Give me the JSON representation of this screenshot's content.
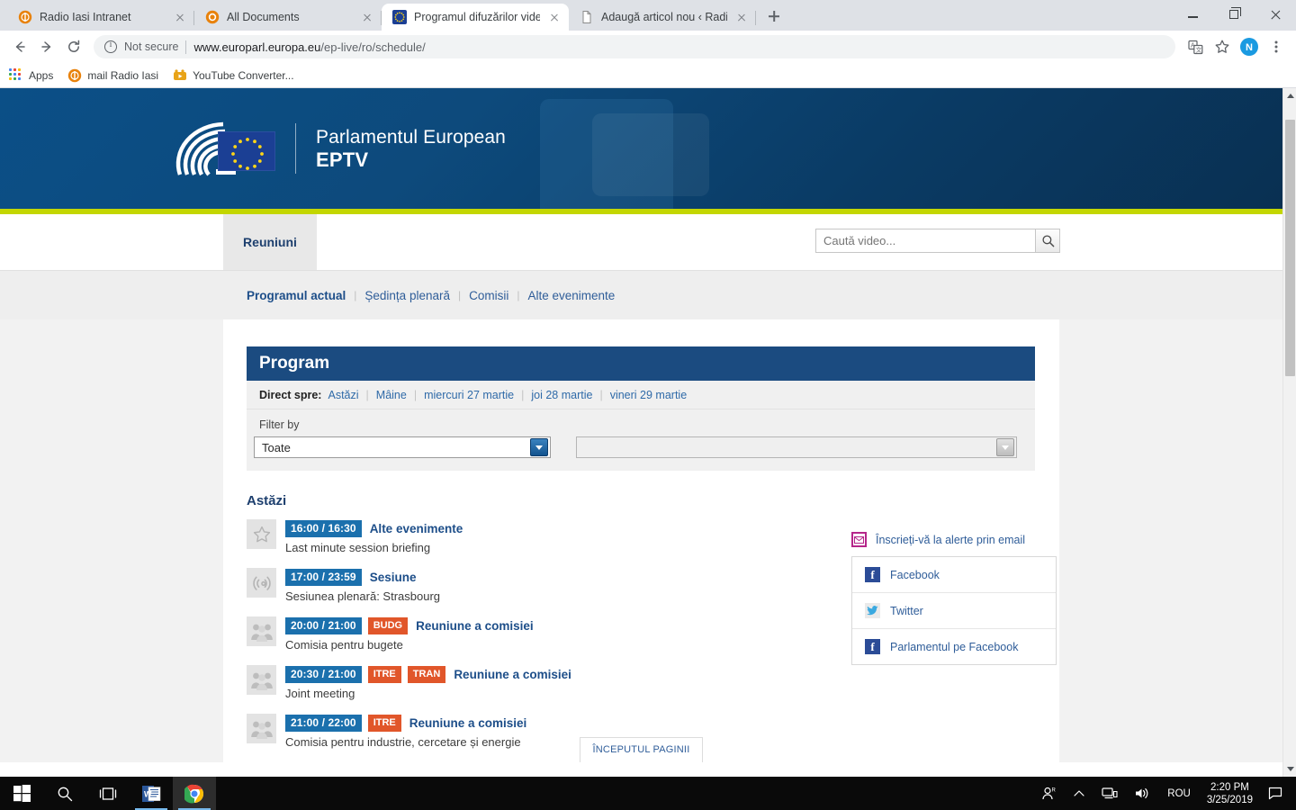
{
  "browser": {
    "tabs": [
      {
        "title": "Radio Iasi Intranet",
        "favicon": "radio-orange-icon",
        "active": false
      },
      {
        "title": "All Documents",
        "favicon": "sharepoint-orange-icon",
        "active": false
      },
      {
        "title": "Programul difuzărilor video | Mul",
        "favicon": "eu-flag-icon",
        "active": true
      },
      {
        "title": "Adaugă articol nou ‹ Radio Iaşi –",
        "favicon": "page-icon",
        "active": false
      }
    ],
    "new_tab_label": "+",
    "window_controls": {
      "minimize": "minimize-button",
      "maximize": "maximize-button",
      "close": "close-button"
    },
    "omnibox": {
      "security_label": "Not secure",
      "url_host": "www.europarl.europa.eu",
      "url_path": "/ep-live/ro/schedule/"
    },
    "toolbar_icons": [
      "back-icon",
      "forward-icon",
      "reload-icon",
      "translate-icon",
      "bookmark-star-icon",
      "profile-avatar",
      "chrome-menu-icon"
    ],
    "profile_initial": "N",
    "bookmarks": [
      {
        "label": "Apps",
        "icon": "apps-grid-icon"
      },
      {
        "label": "mail Radio Iasi",
        "icon": "radio-orange-icon"
      },
      {
        "label": "YouTube Converter...",
        "icon": "youtube-converter-icon"
      }
    ]
  },
  "banner": {
    "institution": "Parlamentul European",
    "product": "EPTV",
    "logo_name": "european-parliament-hemicycle-logo",
    "accent_green": "#c3d600",
    "bg_blue": "#0b4f87"
  },
  "nav": {
    "active_tab": "Reuniuni",
    "search": {
      "placeholder": "Caută video...",
      "value": "",
      "button": "search-icon"
    },
    "subnav": [
      {
        "label": "Programul actual",
        "active": true
      },
      {
        "label": "Ședința plenară",
        "active": false
      },
      {
        "label": "Comisii",
        "active": false
      },
      {
        "label": "Alte evenimente",
        "active": false
      }
    ]
  },
  "program": {
    "title": "Program",
    "direct_label": "Direct spre:",
    "direct_links": [
      "Astăzi",
      "Mâine",
      "miercuri 27 martie",
      "joi 28 martie",
      "vineri 29 martie"
    ],
    "filter_label": "Filter by",
    "filter_primary_value": "Toate",
    "filter_secondary_value": "",
    "day_heading": "Astăzi",
    "events": [
      {
        "icon": "star-outline-icon",
        "time": "16:00 / 16:30",
        "committees": [],
        "type": "Alte evenimente",
        "description": "Last minute session briefing"
      },
      {
        "icon": "broadcast-signal-icon",
        "time": "17:00 / 23:59",
        "committees": [],
        "type": "Sesiune",
        "description": "Sesiunea plenară: Strasbourg"
      },
      {
        "icon": "committee-people-icon",
        "time": "20:00 / 21:00",
        "committees": [
          "BUDG"
        ],
        "type": "Reuniune a comisiei",
        "description": "Comisia pentru bugete"
      },
      {
        "icon": "committee-people-icon",
        "time": "20:30 / 21:00",
        "committees": [
          "ITRE",
          "TRAN"
        ],
        "type": "Reuniune a comisiei",
        "description": "Joint meeting"
      },
      {
        "icon": "committee-people-icon",
        "time": "21:00 / 22:00",
        "committees": [
          "ITRE"
        ],
        "type": "Reuniune a comisiei",
        "description": "Comisia pentru industrie, cercetare și energie"
      }
    ],
    "badge_time_color": "#1b70ad",
    "badge_committee_color": "#e1562a"
  },
  "sidebar": {
    "alert_label": "Înscrieți-vă la alerte prin email",
    "alert_icon": "email-alert-icon",
    "links": [
      {
        "label": "Facebook",
        "icon": "facebook-icon"
      },
      {
        "label": "Twitter",
        "icon": "twitter-icon"
      },
      {
        "label": "Parlamentul pe Facebook",
        "icon": "facebook-icon"
      }
    ]
  },
  "footer": {
    "back_to_top": "ÎNCEPUTUL PAGINII"
  },
  "taskbar": {
    "items": [
      {
        "name": "start-button",
        "icon": "windows-logo-icon"
      },
      {
        "name": "search-button",
        "icon": "search-icon"
      },
      {
        "name": "task-view-button",
        "icon": "task-view-icon"
      },
      {
        "name": "word-button",
        "icon": "word-icon"
      },
      {
        "name": "chrome-button",
        "icon": "chrome-icon"
      }
    ],
    "tray": {
      "people_icon": "people-icon",
      "chevron_icon": "show-hidden-icons-icon",
      "network_icon": "network-icon",
      "volume_icon": "volume-icon",
      "language": "ROU",
      "time": "2:20 PM",
      "date": "3/25/2019",
      "action_center": "action-center-icon"
    }
  }
}
